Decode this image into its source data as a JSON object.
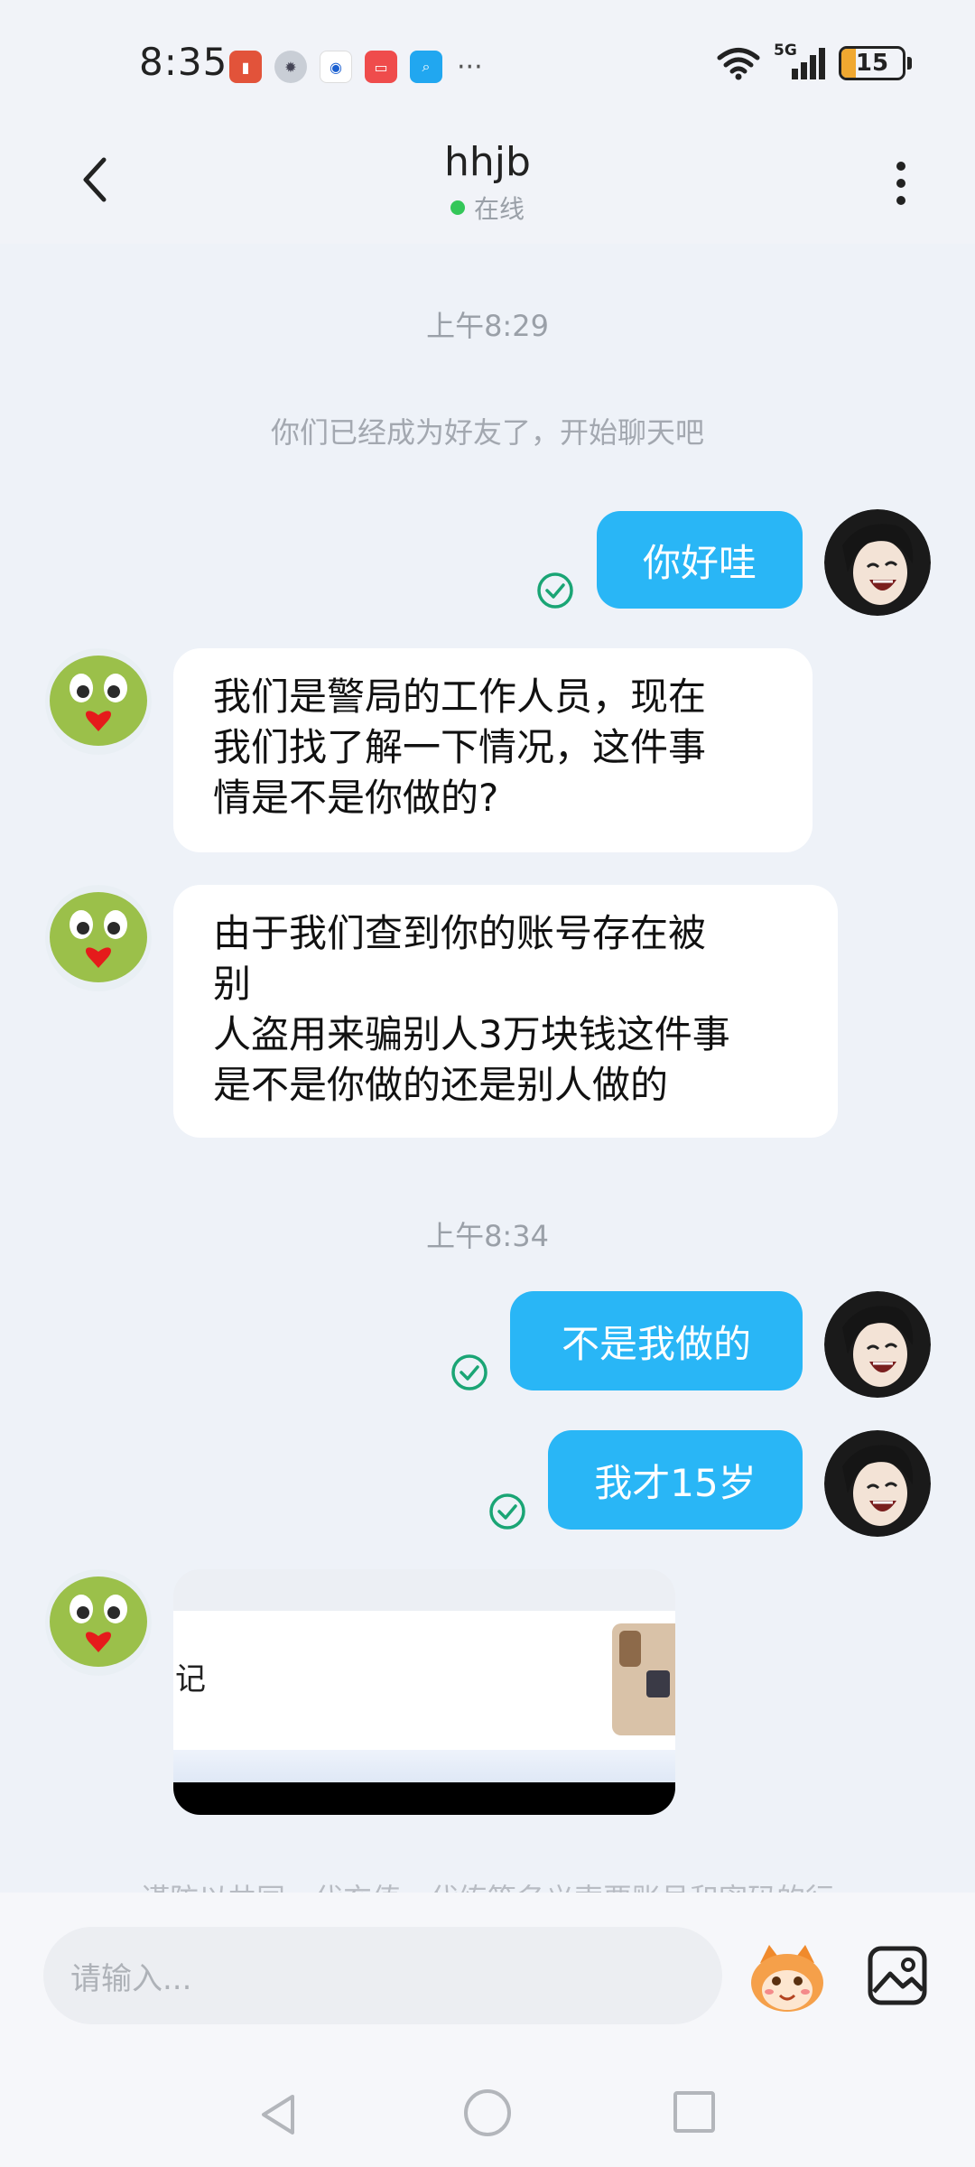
{
  "status_bar": {
    "time": "8:35",
    "network": "5G",
    "battery": "15"
  },
  "header": {
    "title": "hhjb",
    "status": "在线"
  },
  "chat": {
    "timestamp_1": "上午8:29",
    "system_message": "你们已经成为好友了，开始聊天吧",
    "msg_out_1": "你好哇",
    "msg_in_1": "我们是警局的工作人员，现在\n我们找了解一下情况，这件事\n情是不是你做的?",
    "msg_in_2": "由于我们查到你的账号存在被\n别\n人盗用来骗别人3万块钱这件事\n是不是你做的还是别人做的",
    "timestamp_2": "上午8:34",
    "msg_out_2": "不是我做的",
    "msg_out_3": "我才15岁",
    "image_caption_fragment": "记",
    "partial_notice": "谨防以共同、代充值、代练等名义索要账号和密码的行"
  },
  "input": {
    "placeholder": "请输入..."
  },
  "colors": {
    "bubble_out": "#29b6f6",
    "online_dot": "#34c759",
    "read_check": "#1aa575"
  }
}
